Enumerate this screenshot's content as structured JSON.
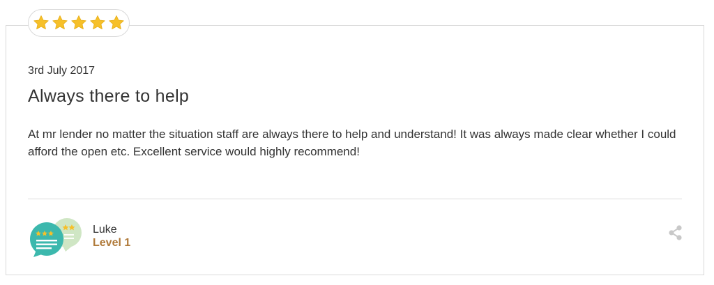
{
  "review": {
    "rating": 5,
    "rating_max": 5,
    "date": "3rd July 2017",
    "title": "Always there to help",
    "body": "At mr lender no matter the situation staff are always there to help and understand! It was always made clear whether I could afford the open etc. Excellent service would highly recommend!"
  },
  "reviewer": {
    "name": "Luke",
    "level": "Level 1",
    "avatar_icon": "speech-bubbles-stars-icon"
  },
  "icons": {
    "rating": "star-icon",
    "share": "share-icon"
  },
  "colors": {
    "star": "#f6c02a",
    "level_text": "#b07a3a",
    "avatar_primary": "#3cb8ad",
    "avatar_secondary": "#cfe6c4",
    "share_icon": "#c8c8c8"
  }
}
